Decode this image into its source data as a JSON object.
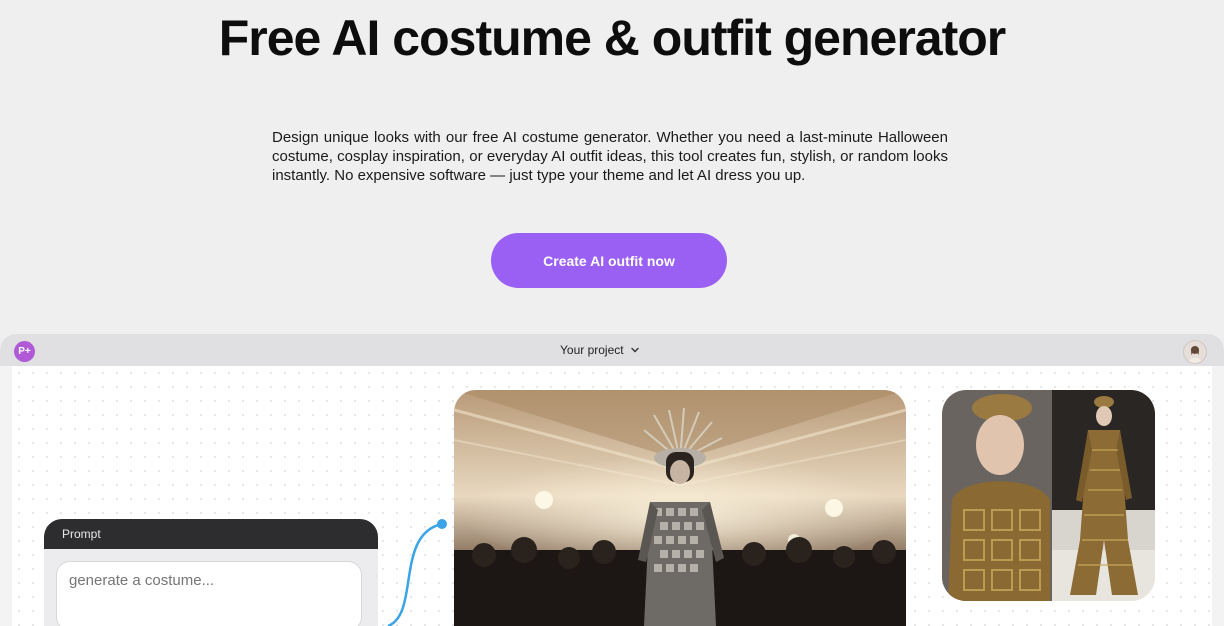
{
  "hero": {
    "title": "Free AI costume & outfit generator",
    "description": "Design unique looks with our free AI costume generator. Whether you need a last-minute Halloween costume, cosplay inspiration, or everyday AI outfit ideas, this tool creates fun, stylish, or random looks instantly. No expensive software — just type your theme and let AI dress you up.",
    "cta_label": "Create AI outfit now"
  },
  "app": {
    "logo_text": "P+",
    "project_label": "Your project",
    "project_icon": "chevron-down-icon",
    "avatar_icon": "user-avatar"
  },
  "prompt": {
    "header": "Prompt",
    "placeholder": "generate a costume..."
  },
  "colors": {
    "accent": "#9a60f4",
    "logo": "#b05ad8",
    "connector": "#3aa4e6",
    "page_bg": "#efeff0"
  }
}
